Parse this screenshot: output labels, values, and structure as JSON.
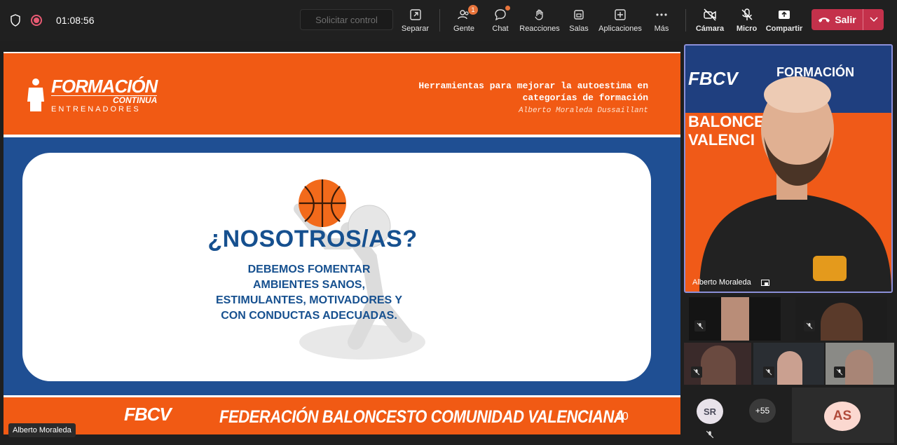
{
  "topbar": {
    "timer": "01:08:56",
    "request_control": "Solicitar control",
    "tools": [
      {
        "label": "Separar",
        "icon": "pop-out-icon"
      },
      {
        "label": "Gente",
        "icon": "people-icon",
        "badge": "1"
      },
      {
        "label": "Chat",
        "icon": "chat-icon"
      },
      {
        "label": "Reacciones",
        "icon": "reactions-icon"
      },
      {
        "label": "Salas",
        "icon": "rooms-icon"
      },
      {
        "label": "Aplicaciones",
        "icon": "apps-icon"
      },
      {
        "label": "Más",
        "icon": "more-icon"
      },
      {
        "label": "Cámara",
        "icon": "camera-off-icon"
      },
      {
        "label": "Micro",
        "icon": "mic-off-icon"
      },
      {
        "label": "Compartir",
        "icon": "share-icon"
      }
    ],
    "leave_label": "Salir"
  },
  "slide": {
    "logo_line1": "FORMACIÓN",
    "logo_line2": "CONTINUA",
    "logo_line3": "ENTRENADORES",
    "title_line1": "Herramientas para mejorar la autoestima en",
    "title_line2": "categorías de formación",
    "author": "Alberto Moraleda Dussaillant",
    "heading": "¿NOSOTROS/AS?",
    "body": [
      "DEBEMOS FOMENTAR",
      "AMBIENTES SANOS,",
      "ESTIMULANTES, MOTIVADORES Y",
      "CON CONDUCTAS ADECUADAS."
    ],
    "footer_logo": "FBCV",
    "footer_title": "FEDERACIÓN BALONCESTO COMUNIDAD VALENCIANA",
    "page_number": "10"
  },
  "presenter_tag": "Alberto Moraleda",
  "speaker": {
    "name": "Alberto Moraleda",
    "bg_logo1": "FBCV",
    "bg_logo2": "FORMACIÓN",
    "bg_text": "BALONCESTO DEL VALENCI"
  },
  "participants": {
    "sr_initials": "SR",
    "more_count": "+55",
    "as_initials": "AS"
  },
  "colors": {
    "accent_orange": "#f15a14",
    "slide_blue": "#1f4f93",
    "leave_red": "#c4314b",
    "speaker_border": "#8b8fd8"
  }
}
